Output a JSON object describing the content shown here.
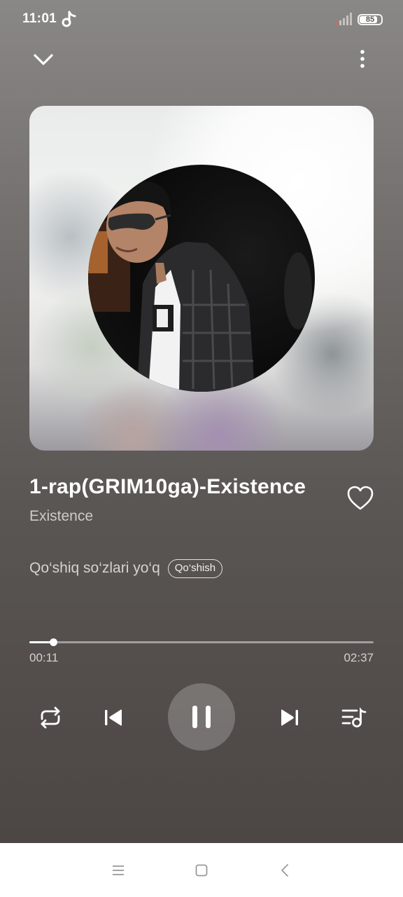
{
  "status_bar": {
    "time": "11:01",
    "battery": "85",
    "battery_level": 0.85
  },
  "player": {
    "song_title": "1-rap(GRIM10ga)-Existence",
    "artist": "Existence",
    "lyrics_status": "Qo‘shiq so‘zlari yo‘q",
    "add_lyrics_label": "Qo‘shish",
    "current_time": "00:11",
    "total_time": "02:37",
    "progress": 0.07,
    "state": "playing",
    "liked": false
  },
  "icons": {
    "collapse": "chevron-down-icon",
    "more": "more-vertical-icon",
    "like": "heart-outline-icon",
    "repeat": "repeat-icon",
    "previous": "skip-previous-icon",
    "pause": "pause-icon",
    "next": "skip-next-icon",
    "queue": "playlist-music-icon"
  },
  "colors": {
    "background_top": "#8a8886",
    "background_bottom": "#4c4644",
    "text_primary": "#ffffff",
    "text_secondary": "#cfcac7"
  },
  "nav_bar": {
    "items": [
      "menu",
      "home",
      "back"
    ]
  }
}
